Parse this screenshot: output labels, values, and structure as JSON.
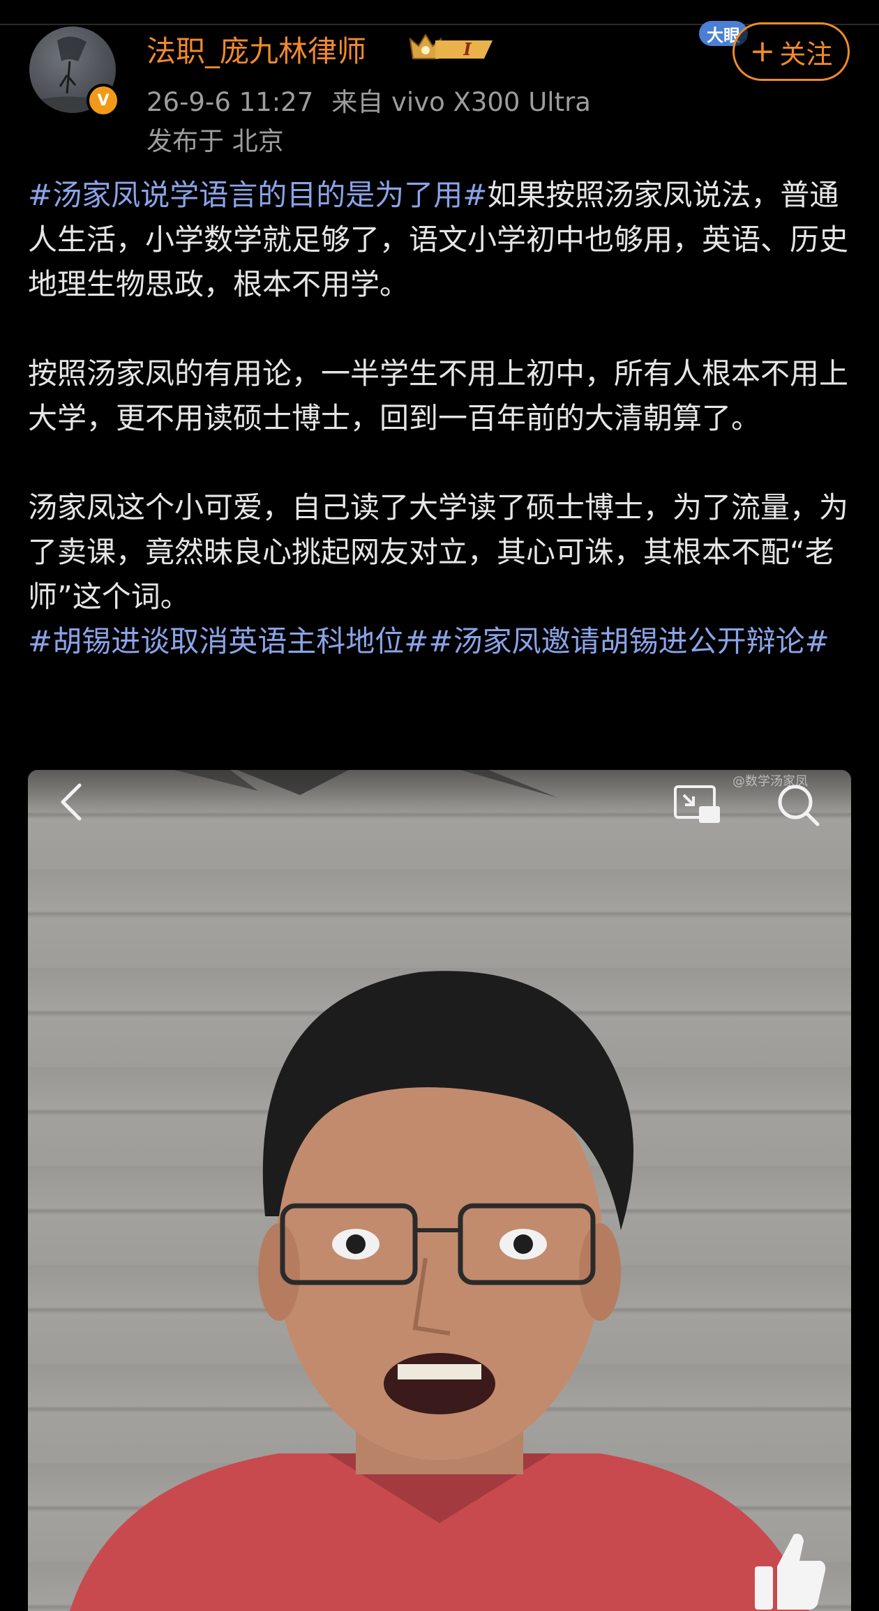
{
  "post": {
    "author": {
      "name": "法职_庞九林律师",
      "verified_badge": "V",
      "level_badge": "I"
    },
    "meta": {
      "datetime": "26-9-6 11:27",
      "source": "来自 vivo X300 Ultra",
      "location": "发布于 北京"
    },
    "sticker_text": "大眼",
    "follow_button": {
      "plus": "+",
      "label": "关注"
    },
    "body": {
      "p1_tag": "#汤家凤说学语言的目的是为了用#",
      "p1_text": "如果按照汤家凤说法，普通人生活，小学数学就足够了，语文小学初中也够用，英语、历史地理生物思政，根本不用学。",
      "p2_text": "按照汤家凤的有用论，一半学生不用上初中，所有人根本不用上大学，更不用读硕士博士，回到一百年前的大清朝算了。",
      "p3_text": "汤家凤这个小可爱，自己读了大学读了硕士博士，为了流量，为了卖课，竟然昧良心挑起网友对立，其心可诛，其根本不配“老师”这个词。",
      "tag2": "#胡锡进谈取消英语主科地位#",
      "tag3": "#汤家凤邀请胡锡进公开辩论#"
    },
    "media": {
      "watermark": "@数学汤家凤",
      "icons": [
        "back-icon",
        "pip-icon",
        "search-icon",
        "like-icon"
      ]
    }
  },
  "colors": {
    "background": "#000000",
    "username": "#f08a2d",
    "hashtag": "#8aa4e8",
    "meta": "#9d9d9d",
    "body_text": "#e6e6e6"
  }
}
